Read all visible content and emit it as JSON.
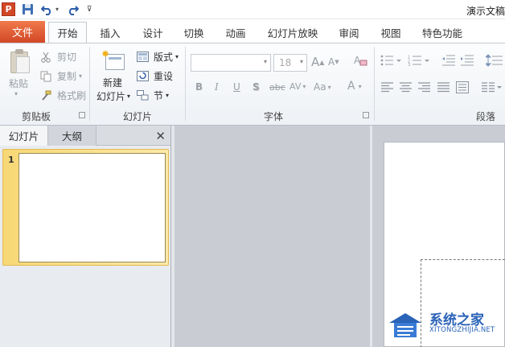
{
  "window": {
    "app_icon": "P",
    "title": "演示文稿"
  },
  "qat": {
    "save_icon": "save-icon",
    "undo_icon": "undo-icon",
    "redo_icon": "redo-icon",
    "dropdown_glyph": "▾",
    "customize_glyph": "⊽"
  },
  "tabs": [
    {
      "label": "文件"
    },
    {
      "label": "开始"
    },
    {
      "label": "插入"
    },
    {
      "label": "设计"
    },
    {
      "label": "切换"
    },
    {
      "label": "动画"
    },
    {
      "label": "幻灯片放映"
    },
    {
      "label": "审阅"
    },
    {
      "label": "视图"
    },
    {
      "label": "特色功能"
    }
  ],
  "ribbon": {
    "clipboard": {
      "paste": "粘贴",
      "cut": "剪切",
      "copy": "复制",
      "format_painter": "格式刷",
      "group_label": "剪贴板"
    },
    "slides": {
      "new_slide_line1": "新建",
      "new_slide_line2": "幻灯片",
      "layout": "版式",
      "reset": "重设",
      "section": "节",
      "group_label": "幻灯片"
    },
    "font": {
      "size": "18",
      "grow": "A",
      "shrink": "A",
      "bold": "B",
      "italic": "I",
      "underline": "U",
      "shadow": "S",
      "strike": "abc",
      "spacing": "AV",
      "case": "Aa",
      "color": "A",
      "group_label": "字体"
    },
    "paragraph": {
      "group_label": "段落"
    }
  },
  "pane": {
    "tab_slides": "幻灯片",
    "tab_outline": "大纲",
    "close": "✕",
    "slide_number": "1"
  },
  "watermark": {
    "name": "系统之家",
    "url": "XITONGZHIJIA.NET"
  }
}
